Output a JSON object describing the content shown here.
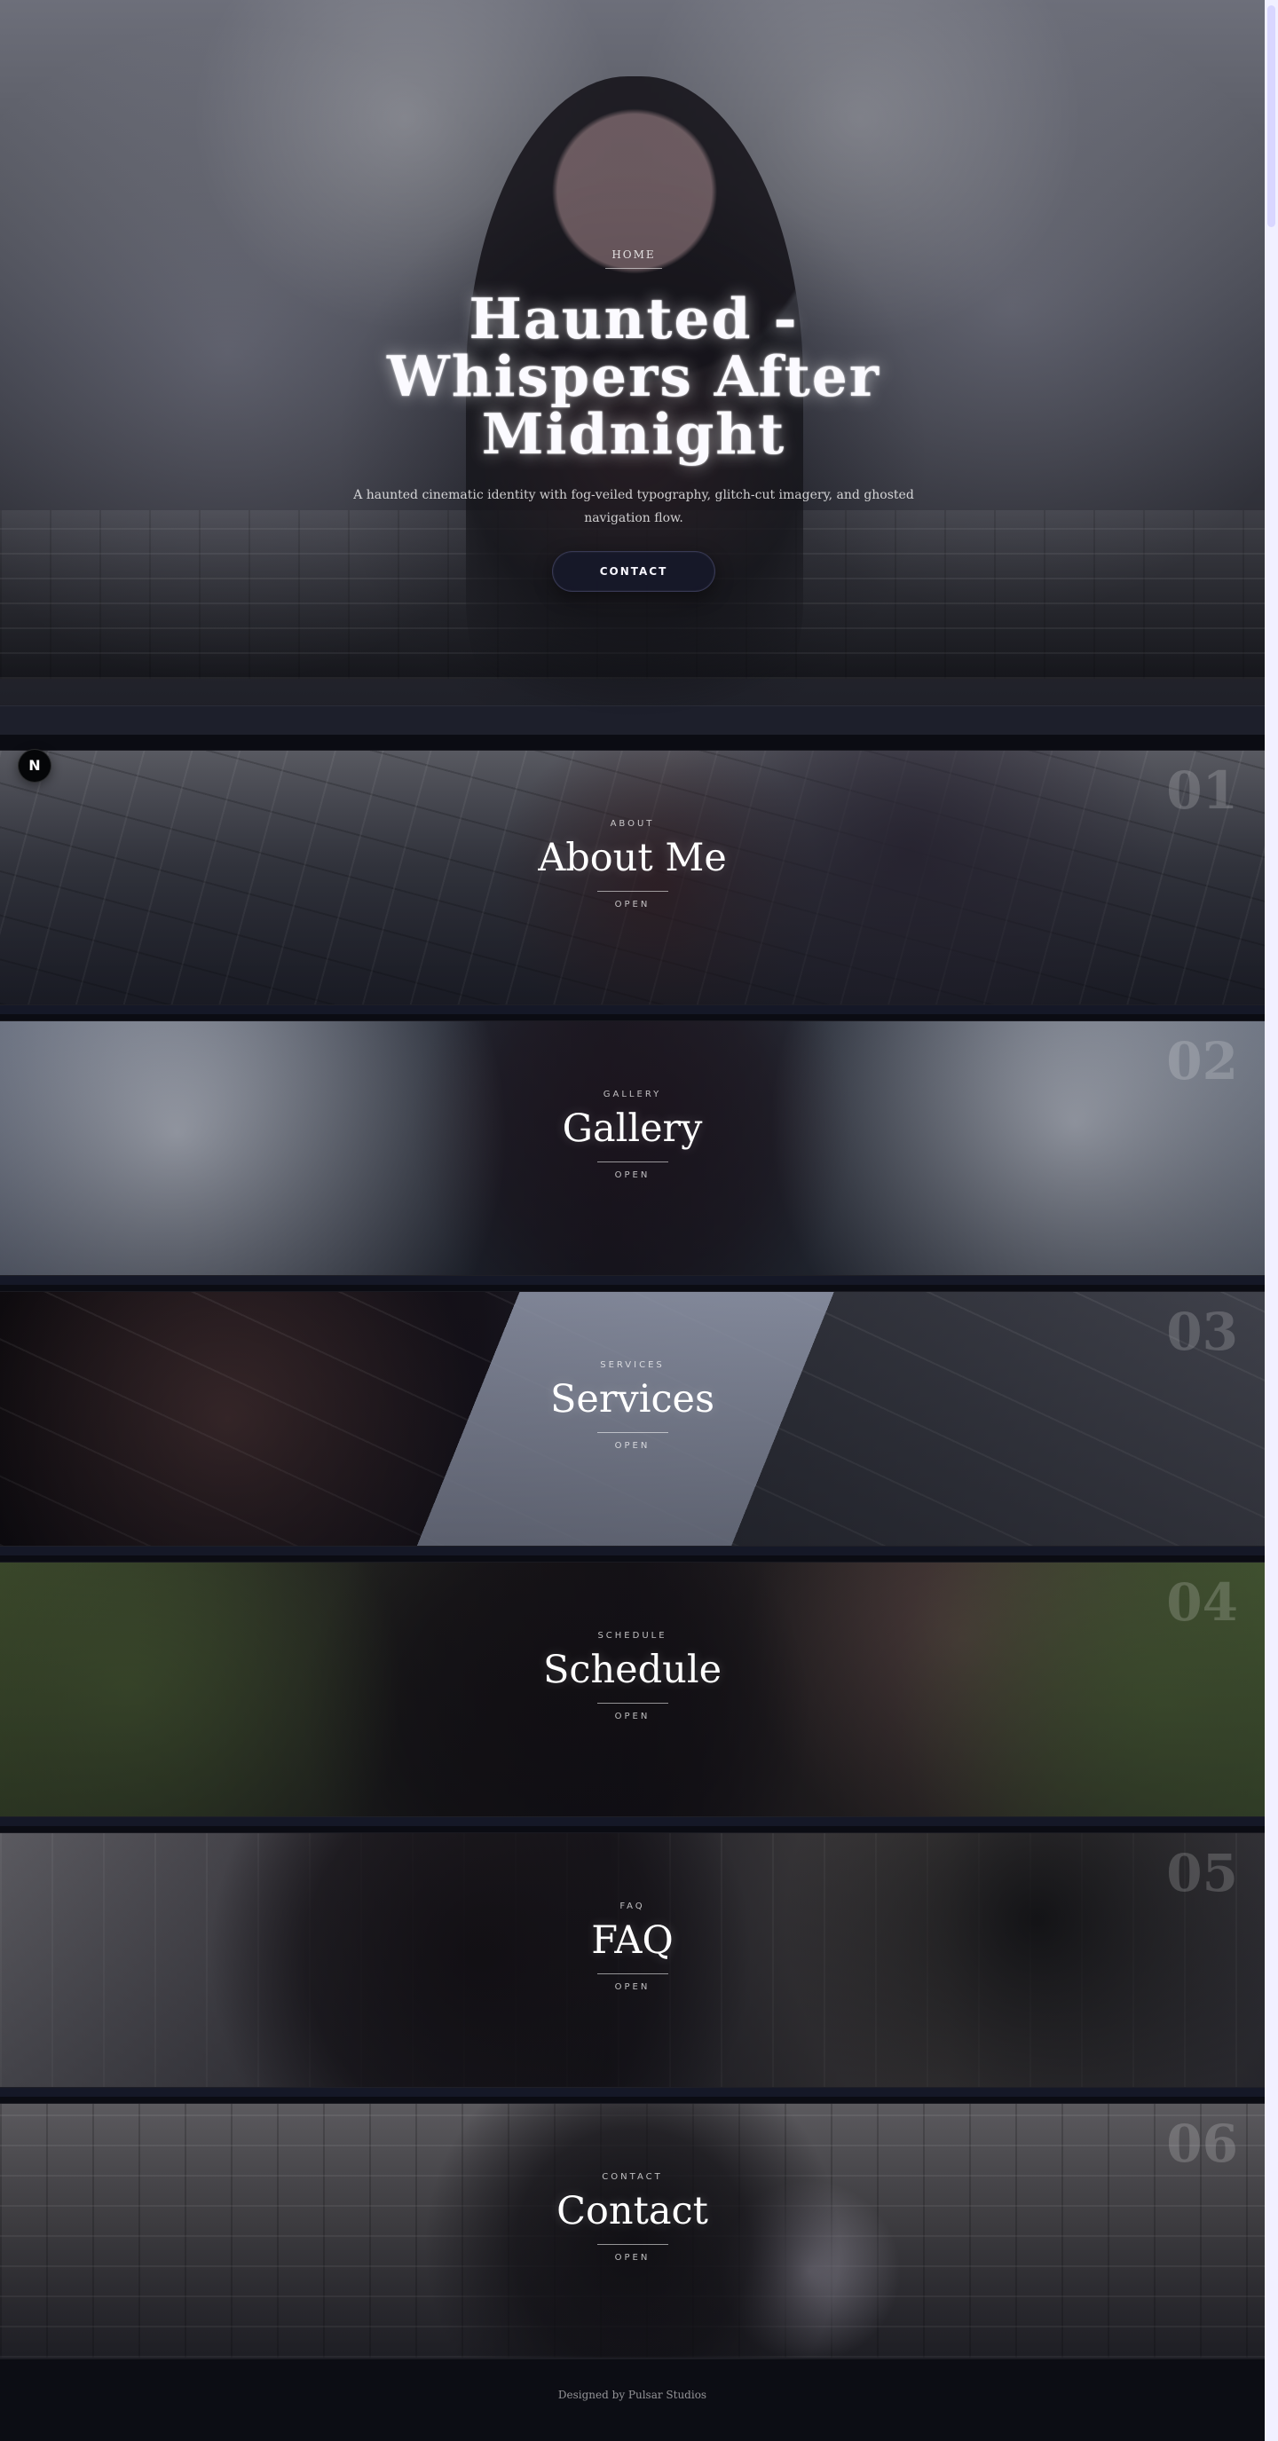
{
  "hero": {
    "nav_label": "HOME",
    "title": "Haunted - Whispers After Midnight",
    "subtitle": "A haunted cinematic identity with fog-veiled typography, glitch-cut imagery, and ghosted navigation flow.",
    "button_label": "CONTACT"
  },
  "logo": {
    "label": "N"
  },
  "sections": [
    {
      "tag": "ABOUT",
      "title": "About Me",
      "open": "OPEN",
      "number": "01"
    },
    {
      "tag": "GALLERY",
      "title": "Gallery",
      "open": "OPEN",
      "number": "02"
    },
    {
      "tag": "SERVICES",
      "title": "Services",
      "open": "OPEN",
      "number": "03"
    },
    {
      "tag": "SCHEDULE",
      "title": "Schedule",
      "open": "OPEN",
      "number": "04"
    },
    {
      "tag": "FAQ",
      "title": "FAQ",
      "open": "OPEN",
      "number": "05"
    },
    {
      "tag": "CONTACT",
      "title": "Contact",
      "open": "OPEN",
      "number": "06"
    }
  ],
  "footer": {
    "credit": "Designed by Pulsar Studios"
  },
  "icons": {
    "logo": "n-logo-icon"
  },
  "colors": {
    "background": "#0b0c13",
    "accent": "#7d6cff",
    "text": "#f3f1ff"
  }
}
